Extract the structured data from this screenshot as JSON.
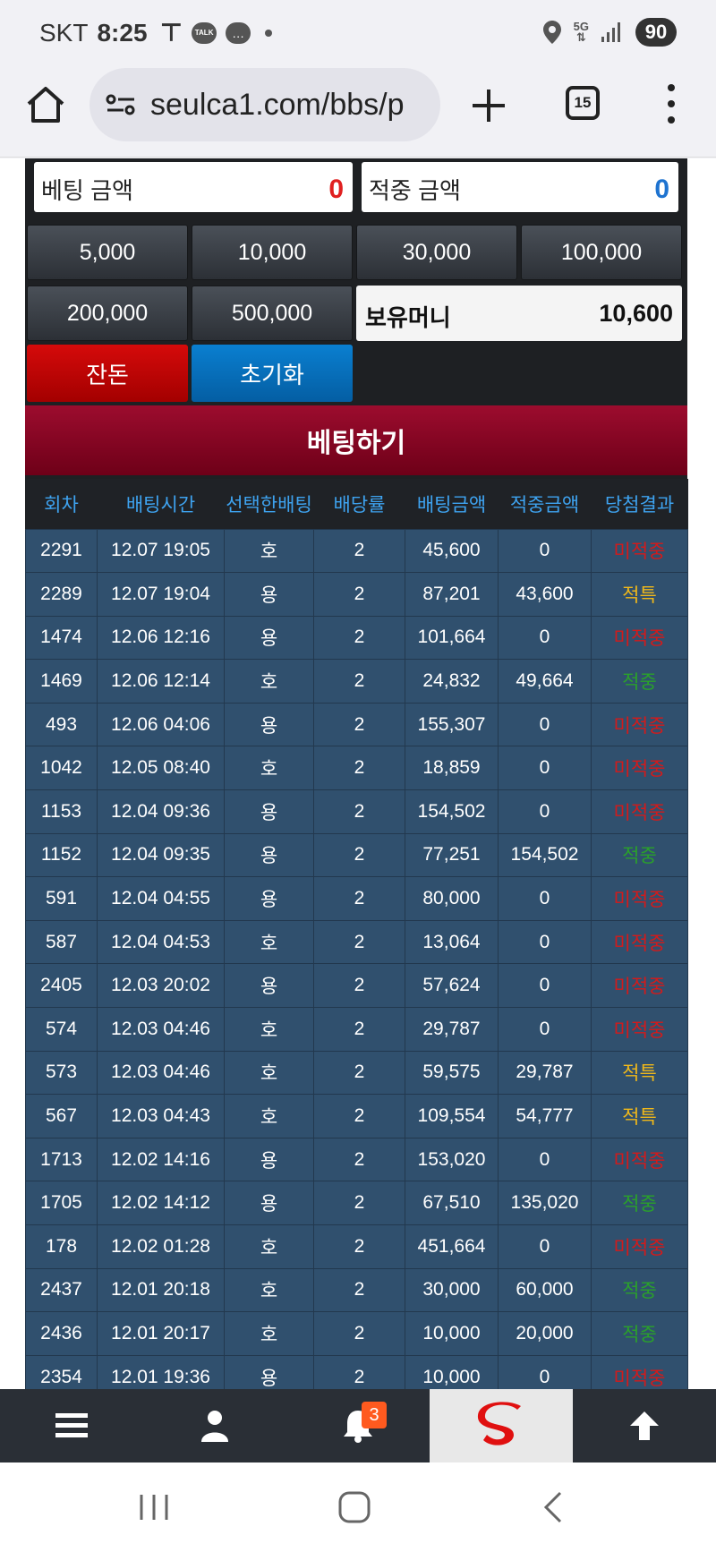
{
  "status_bar": {
    "carrier": "SKT",
    "time": "8:25",
    "talk_label": "TALK",
    "network": "5G",
    "battery": "90"
  },
  "browser": {
    "url": "seulca1.com/bbs/p",
    "tab_count": "15"
  },
  "bet_panel": {
    "bet_amount_label": "베팅 금액",
    "bet_amount_value": "0",
    "hit_amount_label": "적중 금액",
    "hit_amount_value": "0",
    "chips": [
      "5,000",
      "10,000",
      "30,000",
      "100,000",
      "200,000",
      "500,000"
    ],
    "holding_label": "보유머니",
    "holding_value": "10,600",
    "change_button": "잔돈",
    "reset_button": "초기화",
    "bet_button": "베팅하기"
  },
  "history": {
    "headers": [
      "회차",
      "배팅시간",
      "선택한배팅",
      "배당률",
      "배팅금액",
      "적중금액",
      "당첨결과"
    ],
    "rows": [
      {
        "round": "2291",
        "time": "12.07 19:05",
        "pick": "호",
        "odds": "2",
        "bet": "45,600",
        "hit": "0",
        "result": "미적중"
      },
      {
        "round": "2289",
        "time": "12.07 19:04",
        "pick": "용",
        "odds": "2",
        "bet": "87,201",
        "hit": "43,600",
        "result": "적특"
      },
      {
        "round": "1474",
        "time": "12.06 12:16",
        "pick": "용",
        "odds": "2",
        "bet": "101,664",
        "hit": "0",
        "result": "미적중"
      },
      {
        "round": "1469",
        "time": "12.06 12:14",
        "pick": "호",
        "odds": "2",
        "bet": "24,832",
        "hit": "49,664",
        "result": "적중"
      },
      {
        "round": "493",
        "time": "12.06 04:06",
        "pick": "용",
        "odds": "2",
        "bet": "155,307",
        "hit": "0",
        "result": "미적중"
      },
      {
        "round": "1042",
        "time": "12.05 08:40",
        "pick": "호",
        "odds": "2",
        "bet": "18,859",
        "hit": "0",
        "result": "미적중"
      },
      {
        "round": "1153",
        "time": "12.04 09:36",
        "pick": "용",
        "odds": "2",
        "bet": "154,502",
        "hit": "0",
        "result": "미적중"
      },
      {
        "round": "1152",
        "time": "12.04 09:35",
        "pick": "용",
        "odds": "2",
        "bet": "77,251",
        "hit": "154,502",
        "result": "적중"
      },
      {
        "round": "591",
        "time": "12.04 04:55",
        "pick": "용",
        "odds": "2",
        "bet": "80,000",
        "hit": "0",
        "result": "미적중"
      },
      {
        "round": "587",
        "time": "12.04 04:53",
        "pick": "호",
        "odds": "2",
        "bet": "13,064",
        "hit": "0",
        "result": "미적중"
      },
      {
        "round": "2405",
        "time": "12.03 20:02",
        "pick": "용",
        "odds": "2",
        "bet": "57,624",
        "hit": "0",
        "result": "미적중"
      },
      {
        "round": "574",
        "time": "12.03 04:46",
        "pick": "호",
        "odds": "2",
        "bet": "29,787",
        "hit": "0",
        "result": "미적중"
      },
      {
        "round": "573",
        "time": "12.03 04:46",
        "pick": "호",
        "odds": "2",
        "bet": "59,575",
        "hit": "29,787",
        "result": "적특"
      },
      {
        "round": "567",
        "time": "12.03 04:43",
        "pick": "호",
        "odds": "2",
        "bet": "109,554",
        "hit": "54,777",
        "result": "적특"
      },
      {
        "round": "1713",
        "time": "12.02 14:16",
        "pick": "용",
        "odds": "2",
        "bet": "153,020",
        "hit": "0",
        "result": "미적중"
      },
      {
        "round": "1705",
        "time": "12.02 14:12",
        "pick": "용",
        "odds": "2",
        "bet": "67,510",
        "hit": "135,020",
        "result": "적중"
      },
      {
        "round": "178",
        "time": "12.02 01:28",
        "pick": "호",
        "odds": "2",
        "bet": "451,664",
        "hit": "0",
        "result": "미적중"
      },
      {
        "round": "2437",
        "time": "12.01 20:18",
        "pick": "호",
        "odds": "2",
        "bet": "30,000",
        "hit": "60,000",
        "result": "적중"
      },
      {
        "round": "2436",
        "time": "12.01 20:17",
        "pick": "호",
        "odds": "2",
        "bet": "10,000",
        "hit": "20,000",
        "result": "적중"
      },
      {
        "round": "2354",
        "time": "12.01 19:36",
        "pick": "용",
        "odds": "2",
        "bet": "10,000",
        "hit": "0",
        "result": "미적중"
      }
    ]
  },
  "bottom_nav": {
    "items": [
      "menu-icon",
      "user-icon",
      "bell-icon",
      "logo",
      "arrow-up-icon"
    ],
    "notification_count": "3"
  },
  "colors": {
    "lose": "#d41a1a",
    "special": "#f0b81a",
    "win": "#2aa12a",
    "header_text": "#3ea3f0",
    "row_bg": "#30506e"
  }
}
